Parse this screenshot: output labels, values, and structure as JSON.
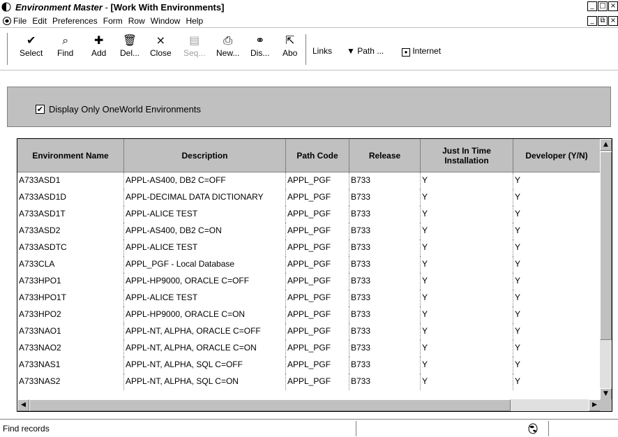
{
  "window": {
    "app_name": "Environment Master",
    "separator": " - ",
    "form_title": "[Work With Environments]",
    "controls": [
      "_",
      "□",
      "×"
    ]
  },
  "menubar": {
    "items": [
      "File",
      "Edit",
      "Preferences",
      "Form",
      "Row",
      "Window",
      "Help"
    ],
    "mdi_controls": [
      "_",
      "⧉",
      "×"
    ]
  },
  "toolbar": {
    "select": "Select",
    "find": "Find",
    "add": "Add",
    "delete": "Del...",
    "close": "Close",
    "seq": "Seq...",
    "new": "New...",
    "dis": "Dis...",
    "abo": "Abo",
    "links": "Links",
    "path": "Path ...",
    "internet": "Internet"
  },
  "filter": {
    "checked": true,
    "label": "Display Only OneWorld Environments"
  },
  "grid": {
    "columns": [
      "Environment Name",
      "Description",
      "Path Code",
      "Release",
      "Just In Time Installation",
      "Developer (Y/N)"
    ],
    "rows": [
      [
        "A733ASD1",
        "APPL-AS400, DB2 C=OFF",
        "APPL_PGF",
        "B733",
        "Y",
        "Y"
      ],
      [
        "A733ASD1D",
        "APPL-DECIMAL DATA DICTIONARY",
        "APPL_PGF",
        "B733",
        "Y",
        "Y"
      ],
      [
        "A733ASD1T",
        "APPL-ALICE TEST",
        "APPL_PGF",
        "B733",
        "Y",
        "Y"
      ],
      [
        "A733ASD2",
        "APPL-AS400, DB2 C=ON",
        "APPL_PGF",
        "B733",
        "Y",
        "Y"
      ],
      [
        "A733ASDTC",
        "APPL-ALICE TEST",
        "APPL_PGF",
        "B733",
        "Y",
        "Y"
      ],
      [
        "A733CLA",
        "APPL_PGF - Local Database",
        "APPL_PGF",
        "B733",
        "Y",
        "Y"
      ],
      [
        "A733HPO1",
        "APPL-HP9000, ORACLE C=OFF",
        "APPL_PGF",
        "B733",
        "Y",
        "Y"
      ],
      [
        "A733HPO1T",
        "APPL-ALICE TEST",
        "APPL_PGF",
        "B733",
        "Y",
        "Y"
      ],
      [
        "A733HPO2",
        "APPL-HP9000, ORACLE C=ON",
        "APPL_PGF",
        "B733",
        "Y",
        "Y"
      ],
      [
        "A733NAO1",
        "APPL-NT, ALPHA, ORACLE C=OFF",
        "APPL_PGF",
        "B733",
        "Y",
        "Y"
      ],
      [
        "A733NAO2",
        "APPL-NT, ALPHA, ORACLE C=ON",
        "APPL_PGF",
        "B733",
        "Y",
        "Y"
      ],
      [
        "A733NAS1",
        "APPL-NT, ALPHA, SQL C=OFF",
        "APPL_PGF",
        "B733",
        "Y",
        "Y"
      ],
      [
        "A733NAS2",
        "APPL-NT, ALPHA, SQL  C=ON",
        "APPL_PGF",
        "B733",
        "Y",
        "Y"
      ]
    ]
  },
  "status": {
    "message": "Find records"
  }
}
